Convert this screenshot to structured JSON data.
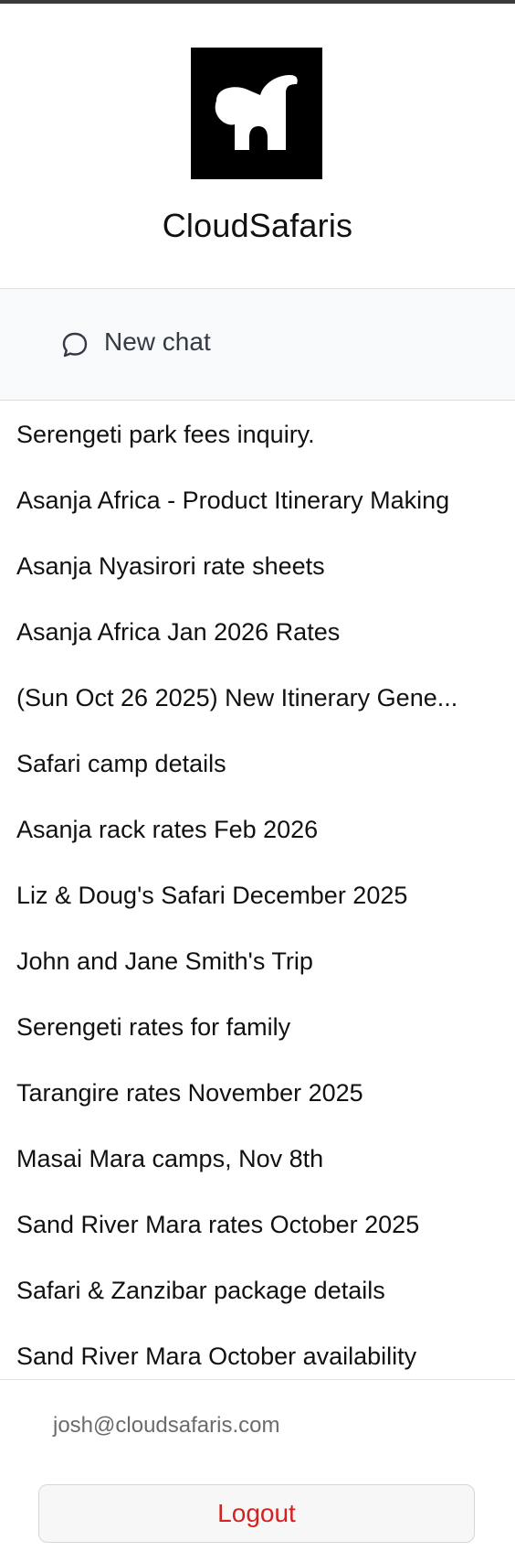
{
  "app": {
    "name": "CloudSafaris",
    "logo_icon": "elephant-icon"
  },
  "new_chat": {
    "icon": "chat-bubble-icon",
    "label": "New chat"
  },
  "chats": [
    {
      "title": "Serengeti park fees inquiry."
    },
    {
      "title": "Asanja Africa - Product Itinerary Making"
    },
    {
      "title": "Asanja Nyasirori rate sheets"
    },
    {
      "title": "Asanja Africa Jan 2026 Rates"
    },
    {
      "title": "(Sun Oct 26 2025) New Itinerary Gene..."
    },
    {
      "title": "Safari camp details"
    },
    {
      "title": "Asanja rack rates Feb 2026"
    },
    {
      "title": "Liz & Doug's Safari December 2025"
    },
    {
      "title": "John and Jane Smith's Trip"
    },
    {
      "title": "Serengeti rates for family"
    },
    {
      "title": "Tarangire rates November 2025"
    },
    {
      "title": "Masai Mara camps, Nov 8th"
    },
    {
      "title": "Sand River Mara rates October 2025"
    },
    {
      "title": "Safari & Zanzibar package details"
    },
    {
      "title": "Sand River Mara October availability"
    }
  ],
  "user": {
    "email": "josh@cloudsafaris.com"
  },
  "logout": {
    "label": "Logout",
    "color": "#d32222"
  }
}
